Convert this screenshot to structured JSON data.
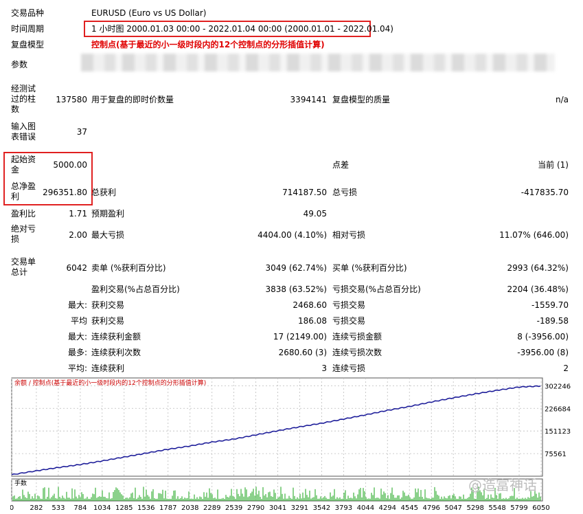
{
  "top": {
    "symbol_label": "交易品种",
    "symbol_value": "EURUSD (Euro vs US Dollar)",
    "period_label": "时间周期",
    "period_value": "1 小时图 2000.01.03 00:00 - 2022.01.04 00:00 (2000.01.01 - 2022.01.04)",
    "model_label": "复盘模型",
    "model_value": "控制点(基于最近的小一级时段内的12个控制点的分形插值计算)",
    "params_label": "参数"
  },
  "stats": {
    "bars_label": "经测试过的柱数",
    "bars_value": "137580",
    "ticks_label": "用于复盘的即时价数量",
    "ticks_value": "3394141",
    "quality_label": "复盘模型的质量",
    "quality_value": "n/a",
    "mismatch_label": "输入图表错误",
    "mismatch_value": "37",
    "deposit_label": "起始资金",
    "deposit_value": "5000.00",
    "spread_label": "点差",
    "spread_value": "当前 (1)",
    "netprofit_label": "总净盈利",
    "netprofit_value": "296351.80",
    "grossprofit_label": "总获利",
    "grossprofit_value": "714187.50",
    "grossloss_label": "总亏损",
    "grossloss_value": "-417835.70",
    "pf_label": "盈利比",
    "pf_value": "1.71",
    "expected_label": "预期盈利",
    "expected_value": "49.05",
    "absdd_label": "绝对亏损",
    "absdd_value": "2.00",
    "maxdd_label": "最大亏损",
    "maxdd_value": "4404.00 (4.10%)",
    "reldd_label": "相对亏损",
    "reldd_value": "11.07% (646.00)",
    "trades_label": "交易单总计",
    "trades_value": "6042",
    "short_label": "卖单 (%获利百分比)",
    "short_value": "3049 (62.74%)",
    "long_label": "买单 (%获利百分比)",
    "long_value": "2993 (64.32%)",
    "win_label": "盈利交易(%占总百分比)",
    "win_value": "3838 (63.52%)",
    "loss_label": "亏损交易(%占总百分比)",
    "loss_value": "2204 (36.48%)",
    "max_label": "最大:",
    "max_win_label": "获利交易",
    "max_win_value": "2468.60",
    "max_loss_label": "亏损交易",
    "max_loss_value": "-1559.70",
    "avg_label": "平均",
    "avg_win_label": "获利交易",
    "avg_win_value": "186.08",
    "avg_loss_label": "亏损交易",
    "avg_loss_value": "-189.58",
    "max2_label": "最大:",
    "cons_win_amt_label": "连续获利金额",
    "cons_win_amt_value": "17 (2149.00)",
    "cons_loss_amt_label": "连续亏损金额",
    "cons_loss_amt_value": "8 (-3956.00)",
    "most_label": "最多:",
    "cons_win_cnt_label": "连续获利次数",
    "cons_win_cnt_value": "2680.60 (3)",
    "cons_loss_cnt_label": "连续亏损次数",
    "cons_loss_cnt_value": "-3956.00 (8)",
    "avg2_label": "平均:",
    "avg_cons_win_label": "连续获利",
    "avg_cons_win_value": "3",
    "avg_cons_loss_label": "连续亏损",
    "avg_cons_loss_value": "2"
  },
  "watermark": "@造富神话",
  "chart_data": {
    "type": "line",
    "title": "余额 / 控制点(基于最近的小一级时段内的12个控制点的分形插值计算)",
    "volume_label": "手数",
    "y_ticks": [
      "302246",
      "226684",
      "151123",
      "75561"
    ],
    "x_ticks": [
      "0",
      "282",
      "533",
      "784",
      "1034",
      "1285",
      "1536",
      "1787",
      "2038",
      "2289",
      "2539",
      "2790",
      "3041",
      "3291",
      "3542",
      "3793",
      "4044",
      "4294",
      "4545",
      "4796",
      "5047",
      "5298",
      "5548",
      "5799",
      "6050"
    ],
    "ylim": [
      0,
      310000
    ],
    "xlim": [
      0,
      6042
    ],
    "series": [
      {
        "values": [
          [
            0,
            5000
          ],
          [
            282,
            18000
          ],
          [
            533,
            29000
          ],
          [
            784,
            39000
          ],
          [
            1034,
            51000
          ],
          [
            1285,
            64000
          ],
          [
            1536,
            77000
          ],
          [
            1787,
            90000
          ],
          [
            2038,
            101000
          ],
          [
            2289,
            114000
          ],
          [
            2539,
            124000
          ],
          [
            2790,
            138000
          ],
          [
            3041,
            152000
          ],
          [
            3291,
            165000
          ],
          [
            3542,
            177000
          ],
          [
            3793,
            191000
          ],
          [
            4044,
            205000
          ],
          [
            4294,
            220000
          ],
          [
            4545,
            233000
          ],
          [
            4796,
            248000
          ],
          [
            5047,
            262000
          ],
          [
            5298,
            275000
          ],
          [
            5548,
            287000
          ],
          [
            5799,
            298000
          ],
          [
            6042,
            301351
          ]
        ]
      }
    ],
    "colors": {
      "balance": "#1e1e9a",
      "volume": "#17a317",
      "grid": "#bcbcbc",
      "header": "#cc0000"
    }
  }
}
